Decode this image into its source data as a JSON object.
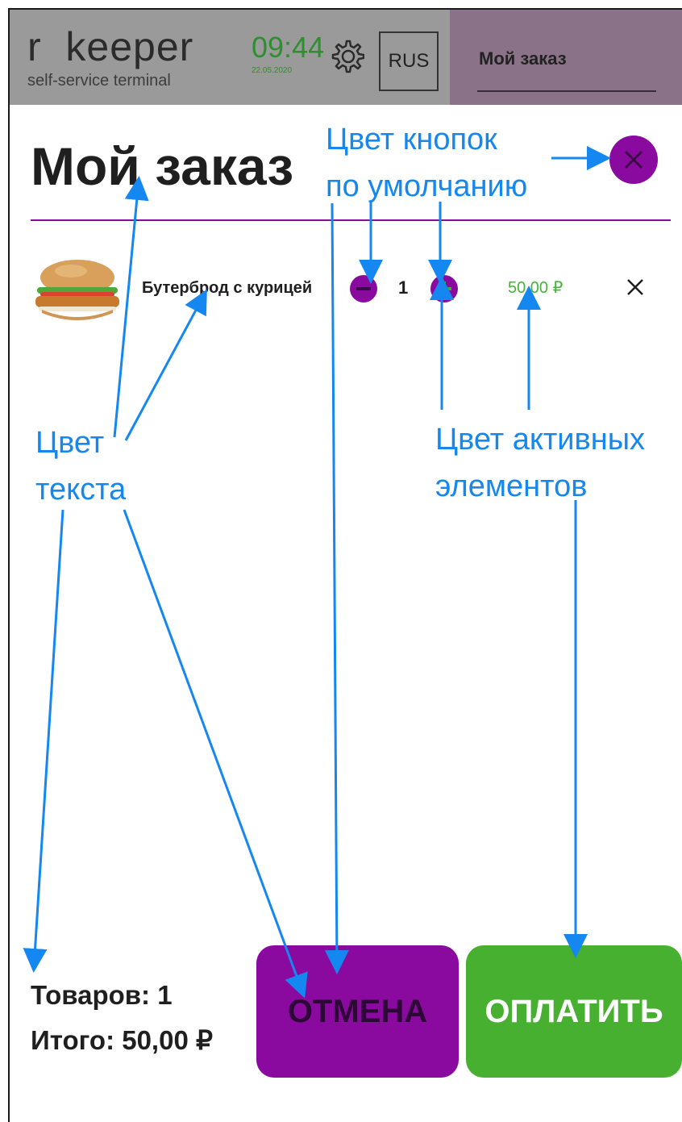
{
  "header": {
    "logo_main": "r  keeper",
    "logo_sub": "self-service terminal",
    "time": "09:44",
    "date": "22.05.2020",
    "settings_icon": "gear-icon",
    "language": "RUS",
    "side_panel_title": "Мой заказ"
  },
  "order": {
    "title": "Мой заказ",
    "close_icon": "close-icon",
    "items": [
      {
        "name": "Бутерброд с курицей",
        "quantity": "1",
        "price": "50,00 ₽",
        "image": "burger-image"
      }
    ]
  },
  "summary": {
    "items_count": "Товаров: 1",
    "total": "Итого: 50,00 ₽"
  },
  "buttons": {
    "cancel": "ОТМЕНА",
    "pay": "ОПЛАТИТЬ"
  },
  "annotations": {
    "default_buttons_color": [
      "Цвет кнопок",
      "по умолчанию"
    ],
    "text_color": [
      "Цвет",
      "текста"
    ],
    "active_elements_color": [
      "Цвет активных",
      "элементов"
    ]
  },
  "colors": {
    "header_bg": "#9a9a9a",
    "side_panel_bg": "#8a7289",
    "default_button": "#8a0aa0",
    "active_element": "#47b030",
    "text": "#1f1f1f",
    "annotation": "#1487f0"
  }
}
